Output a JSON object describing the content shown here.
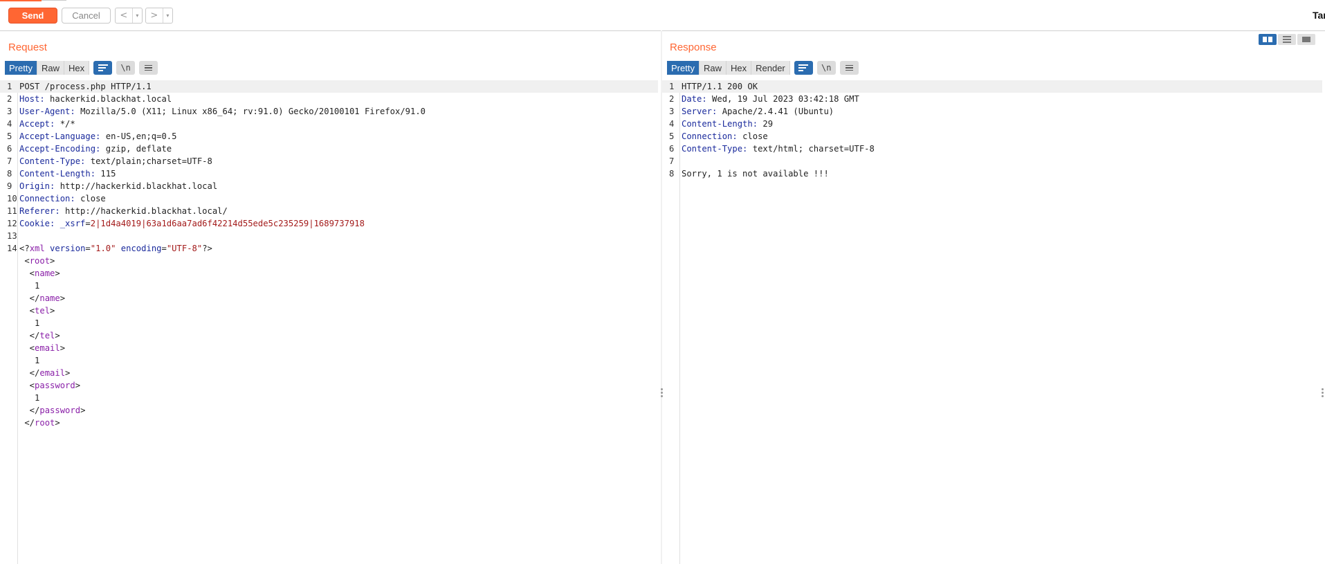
{
  "toolbar": {
    "send_label": "Send",
    "cancel_label": "Cancel",
    "back_arrow": "<",
    "forward_arrow": ">",
    "dropdown_glyph": "▾",
    "target_label": "Target"
  },
  "request": {
    "title": "Request",
    "tabs": [
      "Pretty",
      "Raw",
      "Hex"
    ],
    "active_tab": "Pretty",
    "newline_toggle": "\\n",
    "lines": [
      {
        "n": "1",
        "segments": [
          {
            "t": "POST /process.php HTTP/1.1",
            "c": "plain"
          }
        ]
      },
      {
        "n": "2",
        "segments": [
          {
            "t": "Host: ",
            "c": "hk"
          },
          {
            "t": "hackerkid.blackhat.local",
            "c": "plain"
          }
        ]
      },
      {
        "n": "3",
        "segments": [
          {
            "t": "User-Agent: ",
            "c": "hk"
          },
          {
            "t": "Mozilla/5.0 (X11; Linux x86_64; rv:91.0) Gecko/20100101 Firefox/91.0",
            "c": "plain"
          }
        ]
      },
      {
        "n": "4",
        "segments": [
          {
            "t": "Accept: ",
            "c": "hk"
          },
          {
            "t": "*/*",
            "c": "plain"
          }
        ]
      },
      {
        "n": "5",
        "segments": [
          {
            "t": "Accept-Language: ",
            "c": "hk"
          },
          {
            "t": "en-US,en;q=0.5",
            "c": "plain"
          }
        ]
      },
      {
        "n": "6",
        "segments": [
          {
            "t": "Accept-Encoding: ",
            "c": "hk"
          },
          {
            "t": "gzip, deflate",
            "c": "plain"
          }
        ]
      },
      {
        "n": "7",
        "segments": [
          {
            "t": "Content-Type: ",
            "c": "hk"
          },
          {
            "t": "text/plain;charset=UTF-8",
            "c": "plain"
          }
        ]
      },
      {
        "n": "8",
        "segments": [
          {
            "t": "Content-Length: ",
            "c": "hk"
          },
          {
            "t": "115",
            "c": "plain"
          }
        ]
      },
      {
        "n": "9",
        "segments": [
          {
            "t": "Origin: ",
            "c": "hk"
          },
          {
            "t": "http://hackerkid.blackhat.local",
            "c": "plain"
          }
        ]
      },
      {
        "n": "10",
        "segments": [
          {
            "t": "Connection: ",
            "c": "hk"
          },
          {
            "t": "close",
            "c": "plain"
          }
        ]
      },
      {
        "n": "11",
        "segments": [
          {
            "t": "Referer: ",
            "c": "hk"
          },
          {
            "t": "http://hackerkid.blackhat.local/",
            "c": "plain"
          }
        ]
      },
      {
        "n": "12",
        "segments": [
          {
            "t": "Cookie: ",
            "c": "hk"
          },
          {
            "t": "_xsrf",
            "c": "hk"
          },
          {
            "t": "=",
            "c": "plain"
          },
          {
            "t": "2|1d4a4019|63a1d6aa7ad6f42214d55ede5c235259|1689737918",
            "c": "red"
          }
        ]
      },
      {
        "n": "13",
        "segments": []
      },
      {
        "n": "14",
        "segments": [
          {
            "t": "<?",
            "c": "plain"
          },
          {
            "t": "xml",
            "c": "tag"
          },
          {
            "t": " ",
            "c": "plain"
          },
          {
            "t": "version",
            "c": "attr"
          },
          {
            "t": "=",
            "c": "plain"
          },
          {
            "t": "\"1.0\"",
            "c": "str"
          },
          {
            "t": " ",
            "c": "plain"
          },
          {
            "t": "encoding",
            "c": "attr"
          },
          {
            "t": "=",
            "c": "plain"
          },
          {
            "t": "\"UTF-8\"",
            "c": "str"
          },
          {
            "t": "?>",
            "c": "plain"
          }
        ]
      },
      {
        "n": "",
        "segments": [
          {
            "t": " <",
            "c": "plain"
          },
          {
            "t": "root",
            "c": "tag"
          },
          {
            "t": ">",
            "c": "plain"
          }
        ]
      },
      {
        "n": "",
        "segments": [
          {
            "t": "  <",
            "c": "plain"
          },
          {
            "t": "name",
            "c": "tag"
          },
          {
            "t": ">",
            "c": "plain"
          }
        ]
      },
      {
        "n": "",
        "segments": [
          {
            "t": "   1",
            "c": "plain"
          }
        ]
      },
      {
        "n": "",
        "segments": [
          {
            "t": "  </",
            "c": "plain"
          },
          {
            "t": "name",
            "c": "tag"
          },
          {
            "t": ">",
            "c": "plain"
          }
        ]
      },
      {
        "n": "",
        "segments": [
          {
            "t": "  <",
            "c": "plain"
          },
          {
            "t": "tel",
            "c": "tag"
          },
          {
            "t": ">",
            "c": "plain"
          }
        ]
      },
      {
        "n": "",
        "segments": [
          {
            "t": "   1",
            "c": "plain"
          }
        ]
      },
      {
        "n": "",
        "segments": [
          {
            "t": "  </",
            "c": "plain"
          },
          {
            "t": "tel",
            "c": "tag"
          },
          {
            "t": ">",
            "c": "plain"
          }
        ]
      },
      {
        "n": "",
        "segments": [
          {
            "t": "  <",
            "c": "plain"
          },
          {
            "t": "email",
            "c": "tag"
          },
          {
            "t": ">",
            "c": "plain"
          }
        ]
      },
      {
        "n": "",
        "segments": [
          {
            "t": "   1",
            "c": "plain"
          }
        ]
      },
      {
        "n": "",
        "segments": [
          {
            "t": "  </",
            "c": "plain"
          },
          {
            "t": "email",
            "c": "tag"
          },
          {
            "t": ">",
            "c": "plain"
          }
        ]
      },
      {
        "n": "",
        "segments": [
          {
            "t": "  <",
            "c": "plain"
          },
          {
            "t": "password",
            "c": "tag"
          },
          {
            "t": ">",
            "c": "plain"
          }
        ]
      },
      {
        "n": "",
        "segments": [
          {
            "t": "   1",
            "c": "plain"
          }
        ]
      },
      {
        "n": "",
        "segments": [
          {
            "t": "  </",
            "c": "plain"
          },
          {
            "t": "password",
            "c": "tag"
          },
          {
            "t": ">",
            "c": "plain"
          }
        ]
      },
      {
        "n": "",
        "segments": [
          {
            "t": " </",
            "c": "plain"
          },
          {
            "t": "root",
            "c": "tag"
          },
          {
            "t": ">",
            "c": "plain"
          }
        ]
      }
    ]
  },
  "response": {
    "title": "Response",
    "tabs": [
      "Pretty",
      "Raw",
      "Hex",
      "Render"
    ],
    "active_tab": "Pretty",
    "newline_toggle": "\\n",
    "lines": [
      {
        "n": "1",
        "segments": [
          {
            "t": "HTTP/1.1 200 OK",
            "c": "plain"
          }
        ]
      },
      {
        "n": "2",
        "segments": [
          {
            "t": "Date: ",
            "c": "hk"
          },
          {
            "t": "Wed, 19 Jul 2023 03:42:18 GMT",
            "c": "plain"
          }
        ]
      },
      {
        "n": "3",
        "segments": [
          {
            "t": "Server: ",
            "c": "hk"
          },
          {
            "t": "Apache/2.4.41 (Ubuntu)",
            "c": "plain"
          }
        ]
      },
      {
        "n": "4",
        "segments": [
          {
            "t": "Content-Length: ",
            "c": "hk"
          },
          {
            "t": "29",
            "c": "plain"
          }
        ]
      },
      {
        "n": "5",
        "segments": [
          {
            "t": "Connection: ",
            "c": "hk"
          },
          {
            "t": "close",
            "c": "plain"
          }
        ]
      },
      {
        "n": "6",
        "segments": [
          {
            "t": "Content-Type: ",
            "c": "hk"
          },
          {
            "t": "text/html; charset=UTF-8",
            "c": "plain"
          }
        ]
      },
      {
        "n": "7",
        "segments": []
      },
      {
        "n": "8",
        "segments": [
          {
            "t": "Sorry, 1 is not available !!!",
            "c": "plain"
          }
        ]
      }
    ]
  },
  "colors": {
    "accent": "#ff6633",
    "active_tab": "#2b6cb0",
    "header_key": "#1a2a9c",
    "string_value": "#a31a1a",
    "xml_tag": "#8a1fa8"
  }
}
